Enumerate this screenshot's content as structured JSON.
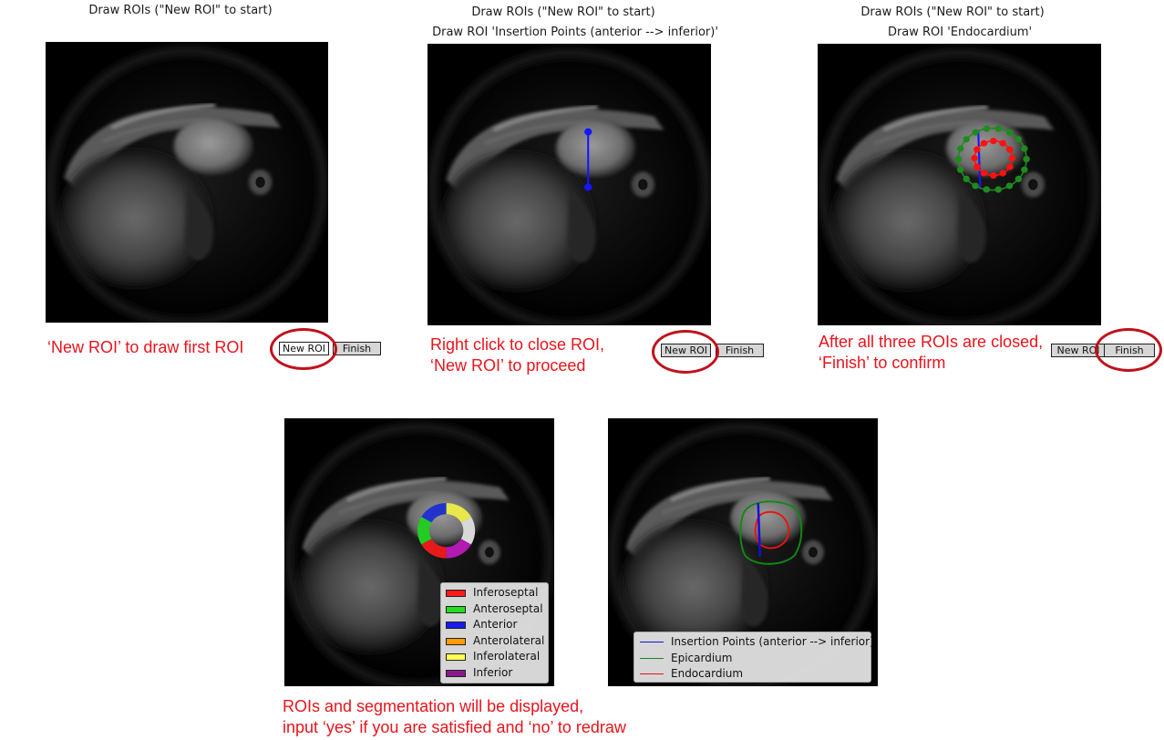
{
  "panels": {
    "step1": {
      "title": "Draw ROIs (\"New ROI\" to start)",
      "buttons": {
        "new_roi": "New ROI",
        "finish": "Finish"
      },
      "annotation": "‘New ROI’ to draw first ROI"
    },
    "step2": {
      "title": "Draw ROIs (\"New ROI\" to start)",
      "subtitle": "Draw ROI 'Insertion Points (anterior --> inferior)'",
      "buttons": {
        "new_roi": "New ROI",
        "finish": "Finish"
      },
      "annotation_line1": "Right click to close ROI,",
      "annotation_line2": "‘New ROI’ to proceed"
    },
    "step3": {
      "title": "Draw ROIs (\"New ROI\" to start)",
      "subtitle": "Draw ROI 'Endocardium'",
      "buttons": {
        "new_roi": "New ROI",
        "finish": "Finish"
      },
      "annotation_line1": "After all three ROIs are closed,",
      "annotation_line2": "‘Finish’ to confirm"
    },
    "segmentation": {
      "legend": [
        {
          "label": "Inferoseptal",
          "color": "#ff1a1a"
        },
        {
          "label": "Anteroseptal",
          "color": "#22dd22"
        },
        {
          "label": "Anterior",
          "color": "#1a1aee"
        },
        {
          "label": "Anterolateral",
          "color": "#ff9a00"
        },
        {
          "label": "Inferolateral",
          "color": "#ffff55"
        },
        {
          "label": "Inferior",
          "color": "#8a1a8a"
        }
      ],
      "annotation_line1": "ROIs and segmentation will be displayed,",
      "annotation_line2": "input ‘yes’ if you are satisfied and ‘no’ to redraw"
    },
    "contours": {
      "legend": [
        {
          "label": "Insertion Points (anterior --> inferior)",
          "color": "#1010dd"
        },
        {
          "label": "Epicardium",
          "color": "#118811"
        },
        {
          "label": "Endocardium",
          "color": "#ee1111"
        }
      ]
    }
  },
  "colors": {
    "accent_red": "#e8141c",
    "highlight_circle": "#c0111b"
  },
  "icons": {
    "marker": "circle-marker"
  }
}
